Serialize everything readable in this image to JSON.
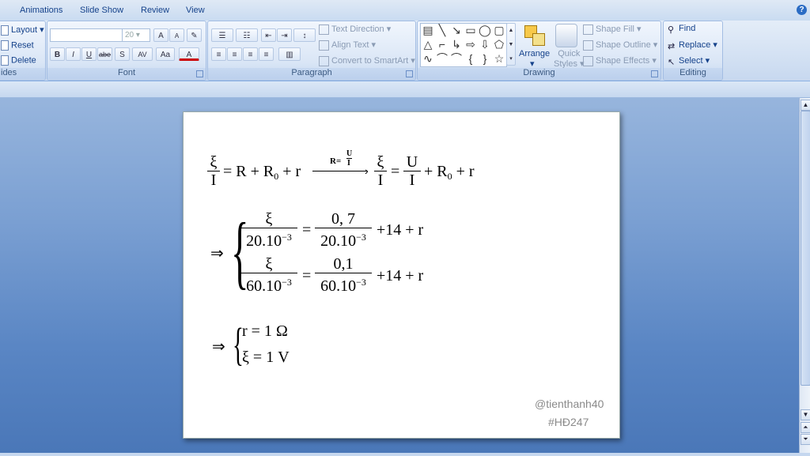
{
  "tabs": [
    "Animations",
    "Slide Show",
    "Review",
    "View"
  ],
  "help_label": "?",
  "ribbon": {
    "slides": {
      "label": "ides",
      "items": [
        "Layout",
        "Reset",
        "Delete"
      ]
    },
    "font": {
      "label": "Font",
      "font_name": "",
      "font_size": "20",
      "buttons": [
        "A",
        "A",
        "B",
        "I",
        "U",
        "abe",
        "S",
        "AV",
        "Aa",
        "A"
      ]
    },
    "paragraph": {
      "label": "Paragraph",
      "items": [
        "Text Direction",
        "Align Text",
        "Convert to SmartArt"
      ]
    },
    "drawing": {
      "label": "Drawing",
      "arrange": "Arrange",
      "quick_styles": [
        "Quick",
        "Styles"
      ],
      "items": [
        "Shape Fill",
        "Shape Outline",
        "Shape Effects"
      ]
    },
    "editing": {
      "label": "Editing",
      "items": [
        "Find",
        "Replace",
        "Select"
      ]
    }
  },
  "slide": {
    "eq1": {
      "xi": "ξ",
      "I": "I",
      "mid1": "= R + R",
      "sub0": "0",
      "mid2": " + r",
      "arrow_label": "R=",
      "arrow_U": "U",
      "arrow_I": "I",
      "U": "U",
      "rhs1": "+ R",
      "rhs2": " + r",
      "eq": "="
    },
    "system1": {
      "implies": "⇒",
      "row1": {
        "num": "ξ",
        "den": "20.10",
        "exp": "−3",
        "num2": "0, 7",
        "rest": "+14 + r"
      },
      "row2": {
        "num": "ξ",
        "den": "60.10",
        "exp": "−3",
        "num2": "0,1",
        "rest": "+14 + r"
      },
      "eq": "="
    },
    "system2": {
      "implies": "⇒",
      "line1": "r = 1 Ω",
      "line2": "ξ = 1 V"
    },
    "watermark1": "@tienthanh40",
    "watermark2": "#HĐ247"
  }
}
